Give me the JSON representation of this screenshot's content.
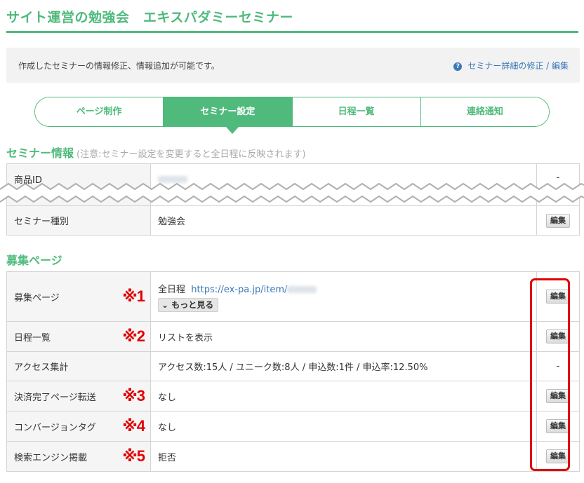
{
  "header": {
    "title": "サイト運営の勉強会　エキスパダミーセミナー"
  },
  "info_bar": {
    "message": "作成したセミナーの情報修正、情報追加が可能です。",
    "help_icon": "?",
    "link": "セミナー詳細の修正 / 編集"
  },
  "tabs": [
    {
      "label": "ページ制作",
      "active": false
    },
    {
      "label": "セミナー設定",
      "active": true
    },
    {
      "label": "日程一覧",
      "active": false
    },
    {
      "label": "連絡通知",
      "active": false
    }
  ],
  "seminar_info": {
    "title": "セミナー情報",
    "note": "(注意:セミナー設定を変更すると全日程に反映されます)",
    "rows": [
      {
        "label": "商品ID",
        "value": "",
        "action": "-"
      },
      {
        "label": "セミナー種別",
        "value": "勉強会",
        "action": "編集"
      }
    ]
  },
  "recruit": {
    "title": "募集ページ",
    "rows": [
      {
        "label": "募集ページ",
        "mark": "※1",
        "prefix": "全日程",
        "url": "https://ex-pa.jp/item/",
        "more": "もっと見る",
        "action": "編集"
      },
      {
        "label": "日程一覧",
        "mark": "※2",
        "value": "リストを表示",
        "action": "編集"
      },
      {
        "label": "アクセス集計",
        "mark": "",
        "value": "アクセス数:15人 / ユニーク数:8人 / 申込数:1件 / 申込率:12.50%",
        "action": "-"
      },
      {
        "label": "決済完了ページ転送",
        "mark": "※3",
        "value": "なし",
        "action": "編集"
      },
      {
        "label": "コンバージョンタグ",
        "mark": "※4",
        "value": "なし",
        "action": "編集"
      },
      {
        "label": "検索エンジン掲載",
        "mark": "※5",
        "value": "拒否",
        "action": "編集"
      }
    ]
  },
  "colors": {
    "accent": "#4fba7c",
    "link": "#3a78b8",
    "highlight": "#e00000"
  }
}
